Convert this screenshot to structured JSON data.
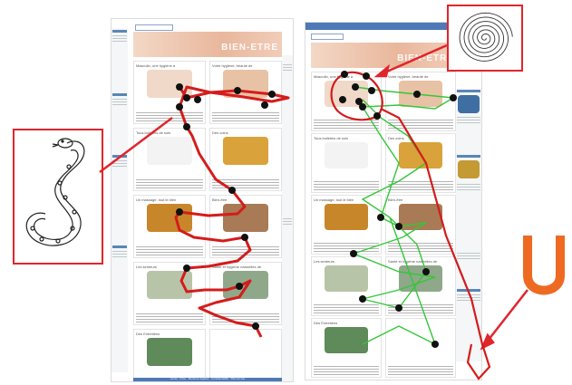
{
  "colors": {
    "red_path": "#d41c1c",
    "green_path": "#35c63a",
    "frame": "#e0252b",
    "u_letter": "#ee6a22",
    "fixation": "#111111",
    "header_blue": "#4d79b8"
  },
  "left_page": {
    "banner_title": "BIEN-ETRE",
    "cell_titles": [
      "Masculin, une hygiène à",
      "Votre hygiène, beauté de",
      "Tous bulletins de soin",
      "Des coins",
      "Un massage, tout le bien",
      "Bien-être",
      "Les senteurs",
      "Santé et hygiène naturelles de",
      "Des Entretiens",
      ""
    ],
    "footer_text": "Accès · Infos · Mentions légales · Confidentialité · Plan du site"
  },
  "right_page": {
    "banner_title": "BIEN-ETRE",
    "cell_titles": [
      "Masculin, une hygiène à",
      "Votre hygiène, beauté de",
      "Tous bulletins de soin",
      "Des coins",
      "Un massage, tout le bien",
      "Bien-être",
      "Les senteurs",
      "Santé et hygiène naturelles de",
      "Des Entretiens",
      ""
    ]
  },
  "icons": {
    "snake": "snake-icon",
    "spiral": "spiral-icon",
    "u_shape": "u-letter-icon"
  }
}
